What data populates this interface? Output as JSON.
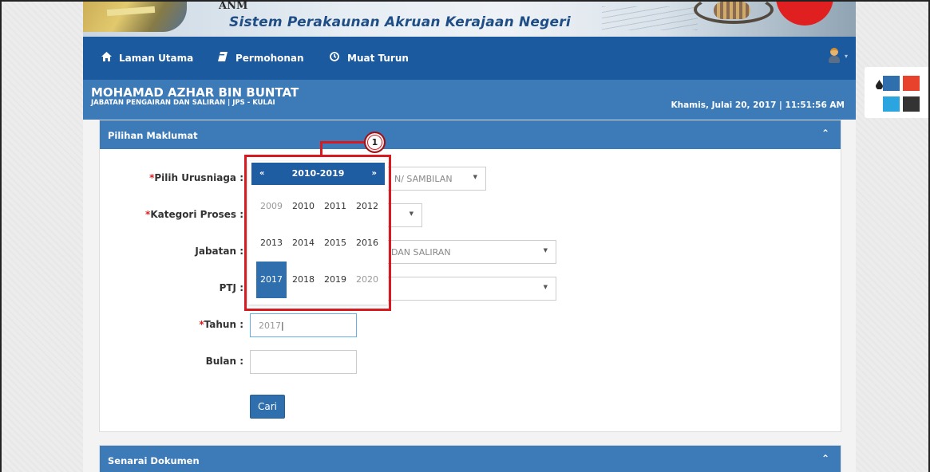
{
  "banner": {
    "abbreviation": "ANM",
    "system_name": "Sistem Perakaunan Akruan Kerajaan Negeri"
  },
  "nav": {
    "items": [
      {
        "label": "Laman Utama",
        "icon": "home-icon"
      },
      {
        "label": "Permohonan",
        "icon": "book-icon"
      },
      {
        "label": "Muat Turun",
        "icon": "clock-download-icon"
      }
    ],
    "user_icon": "user-avatar-icon"
  },
  "user": {
    "name": "MOHAMAD AZHAR BIN BUNTAT",
    "department": "JABATAN PENGAIRAN DAN SALIRAN | JPS - KULAI",
    "datetime": "Khamis, Julai 20, 2017 | 11:51:56 AM"
  },
  "form_panel": {
    "title": "Pilihan Maklumat",
    "fields": {
      "urusniaga": {
        "label": "Pilih Urusniaga :",
        "required": true,
        "value": "N/ SAMBILAN"
      },
      "kategori": {
        "label": "Kategori Proses :",
        "required": true,
        "value": ""
      },
      "jabatan": {
        "label": "Jabatan :",
        "required": false,
        "value": "DAN SALIRAN"
      },
      "ptj": {
        "label": "PTJ :",
        "required": false,
        "value": ""
      },
      "tahun": {
        "label": "Tahun :",
        "required": true,
        "value": "2017"
      },
      "bulan": {
        "label": "Bulan :",
        "required": false,
        "value": ""
      }
    },
    "required_marker": "*",
    "search_button": "Cari"
  },
  "datepicker": {
    "prev": "«",
    "next": "»",
    "range_title": "2010-2019",
    "years": [
      "2009",
      "2010",
      "2011",
      "2012",
      "2013",
      "2014",
      "2015",
      "2016",
      "2017",
      "2018",
      "2019",
      "2020"
    ],
    "selected": "2017",
    "out_of_range": [
      "2009",
      "2020"
    ]
  },
  "callout": {
    "number": "1"
  },
  "list_panel": {
    "title": "Senarai Dokumen"
  },
  "theme_switcher": {
    "icon": "ink-drop-icon",
    "swatches": [
      "#2f6fae",
      "#e8412c",
      "#2aa5e0",
      "#333333"
    ]
  },
  "colors": {
    "nav_bg": "#1c5a9f",
    "panel_head_bg": "#3c7ab8",
    "required": "#e02020",
    "callout": "#d71920"
  }
}
